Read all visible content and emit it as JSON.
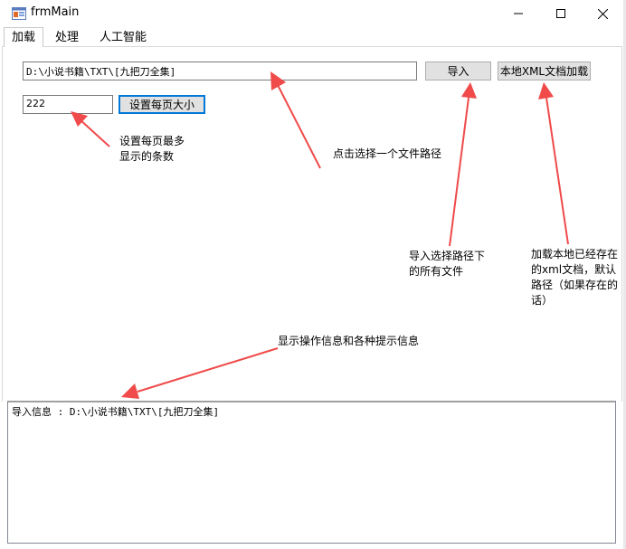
{
  "window": {
    "title": "frmMain",
    "minimize_icon": "minimize-icon",
    "maximize_icon": "maximize-icon",
    "close_icon": "close-icon"
  },
  "tabs": [
    {
      "label": "加载",
      "active": true
    },
    {
      "label": "处理",
      "active": false
    },
    {
      "label": "人工智能",
      "active": false
    }
  ],
  "load_tab": {
    "path_input_value": "D:\\小说书籍\\TXT\\[九把刀全集]",
    "import_button": "导入",
    "load_local_xml_button": "本地XML文档加载",
    "page_size_input_value": "222",
    "set_page_size_button": "设置每页大小"
  },
  "annotations": {
    "page_size_note_line1": "设置每页最多",
    "page_size_note_line2": "显示的条数",
    "path_note": "点击选择一个文件路径",
    "import_note_line1": "导入选择路径下",
    "import_note_line2": "的所有文件",
    "xml_note_line1": "加载本地已经存在",
    "xml_note_line2": "的xml文档，默认",
    "xml_note_line3": "路径（如果存在的",
    "xml_note_line4": "话）",
    "log_note": "显示操作信息和各种提示信息",
    "arrow_color": "#f04a4a"
  },
  "log": {
    "text": "导入信息 : D:\\小说书籍\\TXT\\[九把刀全集]"
  }
}
